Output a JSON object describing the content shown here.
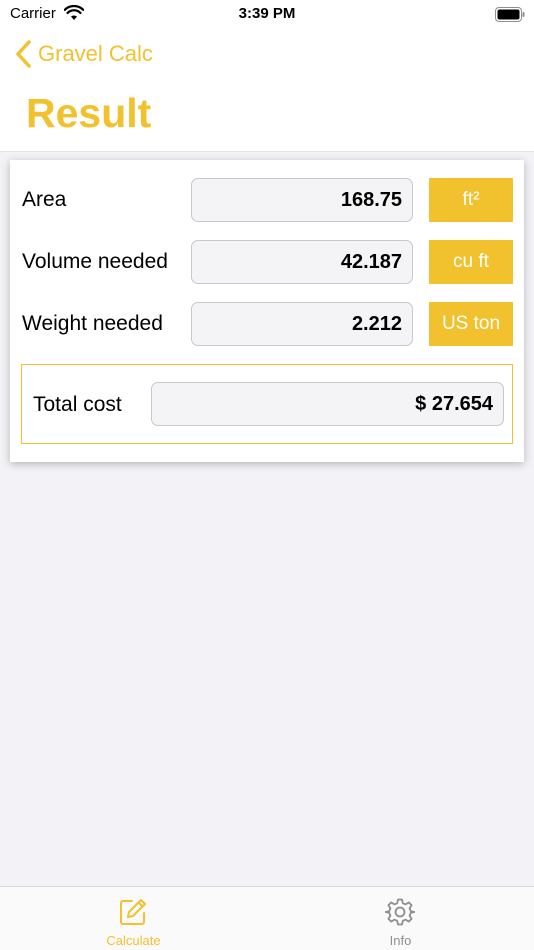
{
  "status_bar": {
    "carrier": "Carrier",
    "time": "3:39 PM"
  },
  "nav": {
    "back_label": "Gravel Calc",
    "title": "Result"
  },
  "results": {
    "rows": [
      {
        "label": "Area",
        "value": "168.75",
        "unit": "ft²"
      },
      {
        "label": "Volume needed",
        "value": "42.187",
        "unit": "cu ft"
      },
      {
        "label": "Weight needed",
        "value": "2.212",
        "unit": "US ton"
      }
    ],
    "total": {
      "label": "Total cost",
      "value": "$ 27.654"
    }
  },
  "tab_bar": {
    "tabs": [
      {
        "label": "Calculate",
        "icon": "edit-icon",
        "active": true
      },
      {
        "label": "Info",
        "icon": "gear-icon",
        "active": false
      }
    ]
  },
  "colors": {
    "accent": "#f2c12e",
    "background": "#f2f2f7",
    "inactive": "#8e8e93"
  }
}
